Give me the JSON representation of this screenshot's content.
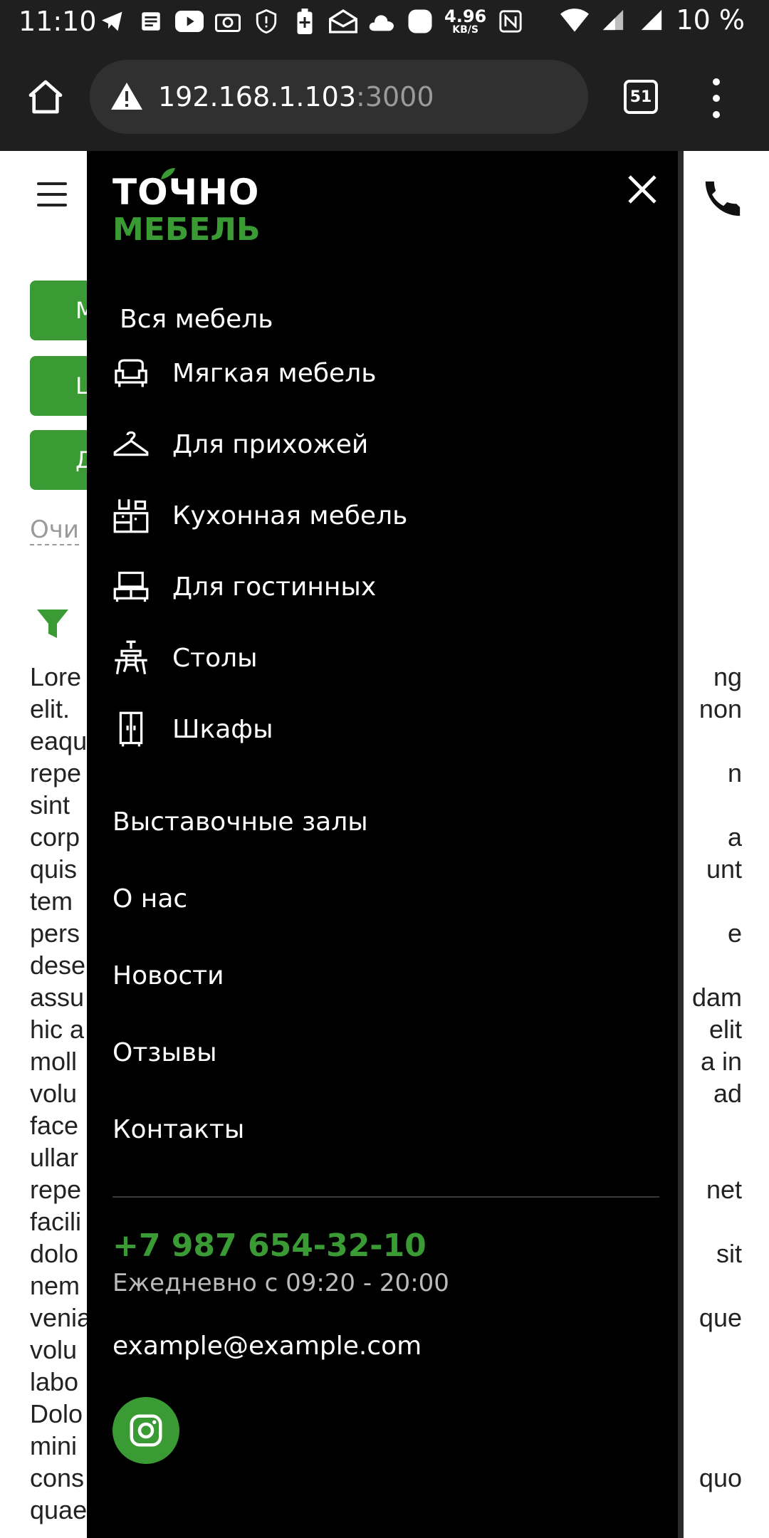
{
  "status_bar": {
    "time": "11:10",
    "speed_value": "4.96",
    "speed_unit": "KB/S",
    "battery_percent": "10 %"
  },
  "browser": {
    "url_host": "192.168.1.103",
    "url_port": ":3000",
    "tab_count": "51"
  },
  "background_page": {
    "buttons": [
      "M",
      "L",
      "Д"
    ],
    "clear_label": "Очи",
    "lorem_rows": [
      [
        "Lore",
        "ng"
      ],
      [
        "elit.",
        "non"
      ],
      [
        "eaqu",
        ""
      ],
      [
        "repe",
        "n"
      ],
      [
        "sint",
        ""
      ],
      [
        "corp",
        "a"
      ],
      [
        "quis",
        "unt"
      ],
      [
        "tem",
        ""
      ],
      [
        "pers",
        "e"
      ],
      [
        "dese",
        ""
      ],
      [
        "assu",
        "dam"
      ],
      [
        "hic a",
        "elit"
      ],
      [
        "moll",
        "a in"
      ],
      [
        "volu",
        "ad"
      ],
      [
        "face",
        ""
      ],
      [
        "ullar",
        ""
      ],
      [
        "repe",
        "net"
      ],
      [
        "facili",
        ""
      ],
      [
        "dolo",
        "sit"
      ],
      [
        "nem",
        ""
      ],
      [
        "venia",
        "que"
      ],
      [
        "volu",
        ""
      ],
      [
        "labo",
        ""
      ],
      [
        "Dolo",
        ""
      ],
      [
        "mini",
        ""
      ],
      [
        "cons",
        "quo"
      ],
      [
        "quae",
        ""
      ]
    ]
  },
  "menu": {
    "logo_top": "ТОЧНО",
    "logo_bottom": "МЕБЕЛЬ",
    "section_title": "Вся мебель",
    "categories": [
      {
        "label": "Мягкая мебель",
        "icon": "armchair-icon"
      },
      {
        "label": "Для прихожей",
        "icon": "hanger-icon"
      },
      {
        "label": "Кухонная мебель",
        "icon": "kitchen-icon"
      },
      {
        "label": "Для гостинных",
        "icon": "tv-stand-icon"
      },
      {
        "label": "Столы",
        "icon": "desk-chair-icon"
      },
      {
        "label": "Шкафы",
        "icon": "wardrobe-icon"
      }
    ],
    "nav": [
      "Выставочные залы",
      "О нас",
      "Новости",
      "Отзывы",
      "Контакты"
    ],
    "phone": "+7 987 654-32-10",
    "hours": "Ежедневно с 09:20 - 20:00",
    "email": "example@example.com",
    "social_icon": "instagram-icon"
  },
  "colors": {
    "accent": "#3a9a34",
    "drawer_bg": "#000000",
    "toolbar_bg": "#1f1f1f"
  }
}
